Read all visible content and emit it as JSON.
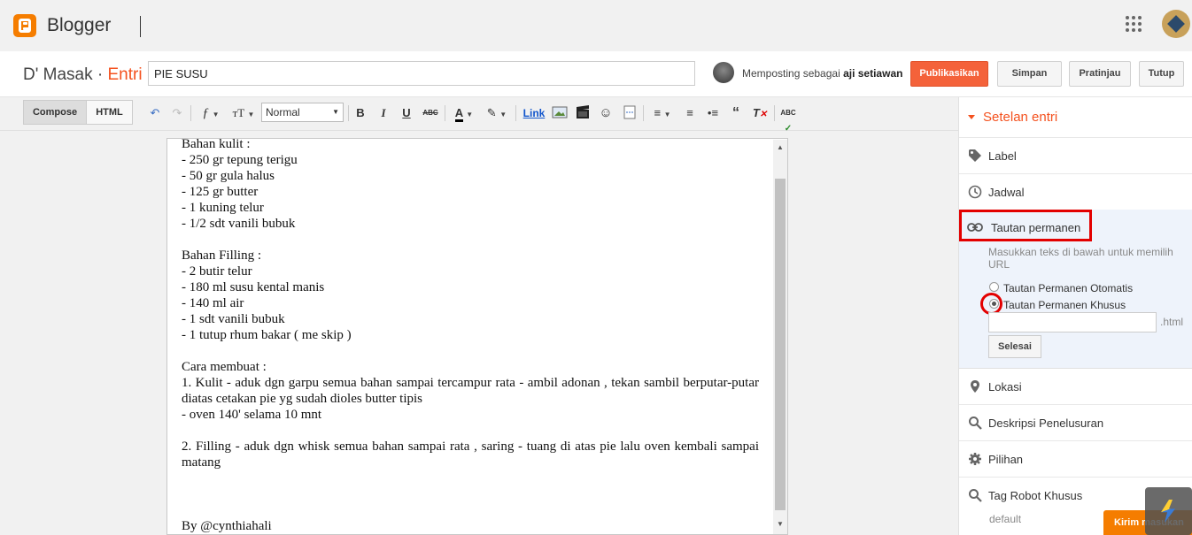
{
  "app": {
    "brand": "Blogger"
  },
  "header": {
    "blog_name": "D' Masak",
    "separator": " · ",
    "section": "Entri",
    "post_title": "PIE SUSU",
    "posting_as_prefix": "Memposting sebagai ",
    "posting_as_user": "aji setiawan",
    "buttons": {
      "publish": "Publikasikan",
      "save": "Simpan",
      "preview": "Pratinjau",
      "close": "Tutup"
    }
  },
  "toolbar": {
    "compose": "Compose",
    "html": "HTML",
    "font_size_style": "Normal",
    "link": "Link"
  },
  "editor": {
    "lines": [
      "Bahan kulit :",
      "- 250 gr tepung terigu",
      "- 50 gr gula halus",
      "- 125 gr butter",
      "- 1 kuning telur",
      "- 1/2 sdt vanili bubuk",
      "",
      "Bahan Filling :",
      "- 2 butir telur",
      "- 180 ml susu kental manis",
      "- 140 ml air",
      "- 1 sdt vanili bubuk",
      "- 1 tutup rhum bakar ( me skip )",
      "",
      "Cara membuat :",
      "1. Kulit - aduk dgn garpu semua bahan sampai tercampur rata - ambil adonan , tekan sambil berputar-putar diatas cetakan pie yg sudah dioles butter tipis",
      "- oven 140' selama 10 mnt",
      "",
      "2. Filling - aduk dgn whisk semua bahan sampai rata , saring - tuang di atas pie lalu oven kembali sampai matang",
      "",
      "",
      "",
      "By @cynthiahali"
    ]
  },
  "sidebar": {
    "header": "Setelan entri",
    "items": {
      "label": "Label",
      "schedule": "Jadwal",
      "permalink": "Tautan permanen",
      "location": "Lokasi",
      "search_desc": "Deskripsi Penelusuran",
      "options": "Pilihan",
      "robot_tags": "Tag Robot Khusus"
    },
    "permalink_panel": {
      "description": "Masukkan teks di bawah untuk memilih URL",
      "auto_option": "Tautan Permanen Otomatis",
      "custom_option": "Tautan Permanen Khusus",
      "suffix": ".html",
      "done": "Selesai"
    },
    "robot_default": "default"
  },
  "feedback": {
    "label": "Kirim masukan"
  }
}
